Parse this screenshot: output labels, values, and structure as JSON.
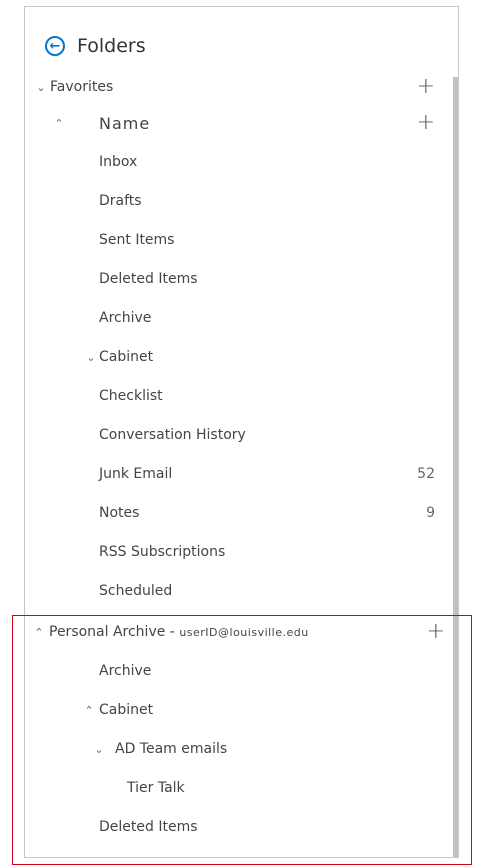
{
  "header": {
    "title": "Folders"
  },
  "favorites": {
    "label": "Favorites"
  },
  "mailbox": {
    "label": "Name"
  },
  "folders": [
    {
      "label": "Inbox",
      "count": ""
    },
    {
      "label": "Drafts",
      "count": ""
    },
    {
      "label": "Sent Items",
      "count": ""
    },
    {
      "label": "Deleted Items",
      "count": ""
    },
    {
      "label": "Archive",
      "count": ""
    },
    {
      "label": "Cabinet",
      "count": ""
    },
    {
      "label": "Checklist",
      "count": ""
    },
    {
      "label": "Conversation History",
      "count": ""
    },
    {
      "label": "Junk Email",
      "count": "52"
    },
    {
      "label": "Notes",
      "count": "9"
    },
    {
      "label": "RSS Subscriptions",
      "count": ""
    },
    {
      "label": "Scheduled",
      "count": ""
    }
  ],
  "archive": {
    "label": "Personal Archive - ",
    "account": "userID@louisville.edu",
    "items": [
      {
        "label": "Archive"
      },
      {
        "label": "Cabinet"
      },
      {
        "label": "AD Team emails"
      },
      {
        "label": "Tier Talk"
      },
      {
        "label": "Deleted Items"
      }
    ]
  },
  "colors": {
    "accent": "#0078d4",
    "highlight_border": "#d0021b",
    "scrollbar": "#c2c2c2"
  },
  "icons": {
    "back": "back-arrow-circle-icon",
    "expand": "chevron-down-icon",
    "collapse": "chevron-up-icon",
    "add": "plus-icon"
  }
}
